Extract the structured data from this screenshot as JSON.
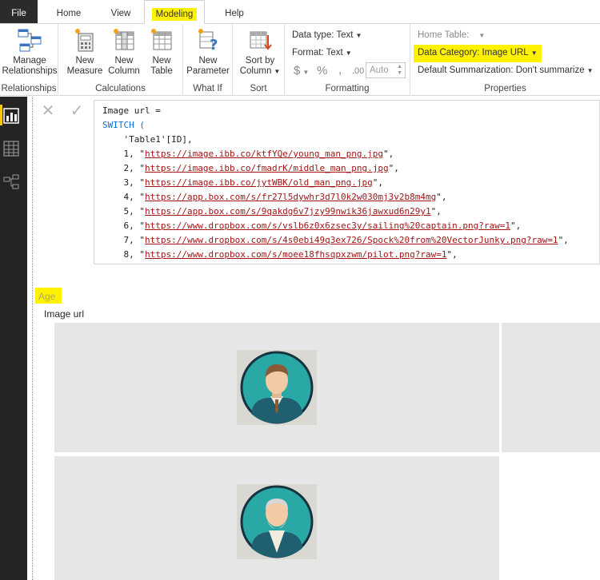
{
  "tabs": [
    "File",
    "Home",
    "View",
    "Modeling",
    "Help"
  ],
  "ribbon": {
    "relationships": {
      "button": "Manage\nRelationships",
      "group": "Relationships"
    },
    "calculations": {
      "new_measure": "New\nMeasure",
      "new_column": "New\nColumn",
      "new_table": "New\nTable",
      "group": "Calculations"
    },
    "whatif": {
      "new_parameter": "New\nParameter",
      "group": "What If"
    },
    "sort": {
      "sort_by_column": "Sort by\nColumn",
      "group": "Sort"
    },
    "formatting": {
      "data_type": "Data type: Text",
      "format": "Format: Text",
      "currency": "$",
      "percent": "%",
      "comma": ",",
      "decimal": ".00",
      "auto": "Auto",
      "group": "Formatting"
    },
    "properties": {
      "home_table": "Home Table:",
      "data_category": "Data Category: Image URL",
      "default_summarization": "Default Summarization: Don't summarize",
      "group": "Properties"
    }
  },
  "formula": {
    "line1": "Image url =",
    "line2": "SWITCH (",
    "line3": "    'Table1'[ID],",
    "rows": [
      {
        "n": "1",
        "url": "https://image.ibb.co/ktfYQe/young_man_png.jpg"
      },
      {
        "n": "2",
        "url": "https://image.ibb.co/fmadrK/middle_man_png.jpg"
      },
      {
        "n": "3",
        "url": "https://image.ibb.co/jytWBK/old_man_png.jpg"
      },
      {
        "n": "4",
        "url": "https://app.box.com/s/fr27l5dywhr3d7l0k2w030mj3v2b8m4mg"
      },
      {
        "n": "5",
        "url": "https://app.box.com/s/9qakdg6v7jzy99nwik36jawxud6n29y1"
      },
      {
        "n": "6",
        "url": "https://www.dropbox.com/s/vslb6z0x6zsec3y/sailing%20captain.png?raw=1"
      },
      {
        "n": "7",
        "url": "https://www.dropbox.com/s/4s0ebi49q3ex726/Spock%20from%20VectorJunky.png?raw=1"
      },
      {
        "n": "8",
        "url": "https://www.dropbox.com/s/moee18fhsqpxzwm/pilot.png?raw=1"
      }
    ]
  },
  "visual": {
    "age_label": "Age",
    "column_header": "Image url"
  },
  "colors": {
    "highlight": "#fff200",
    "keyword": "#0b6fd8",
    "url": "#a31515",
    "rail": "#252423",
    "avatar_teal": "#2aa8a6"
  }
}
